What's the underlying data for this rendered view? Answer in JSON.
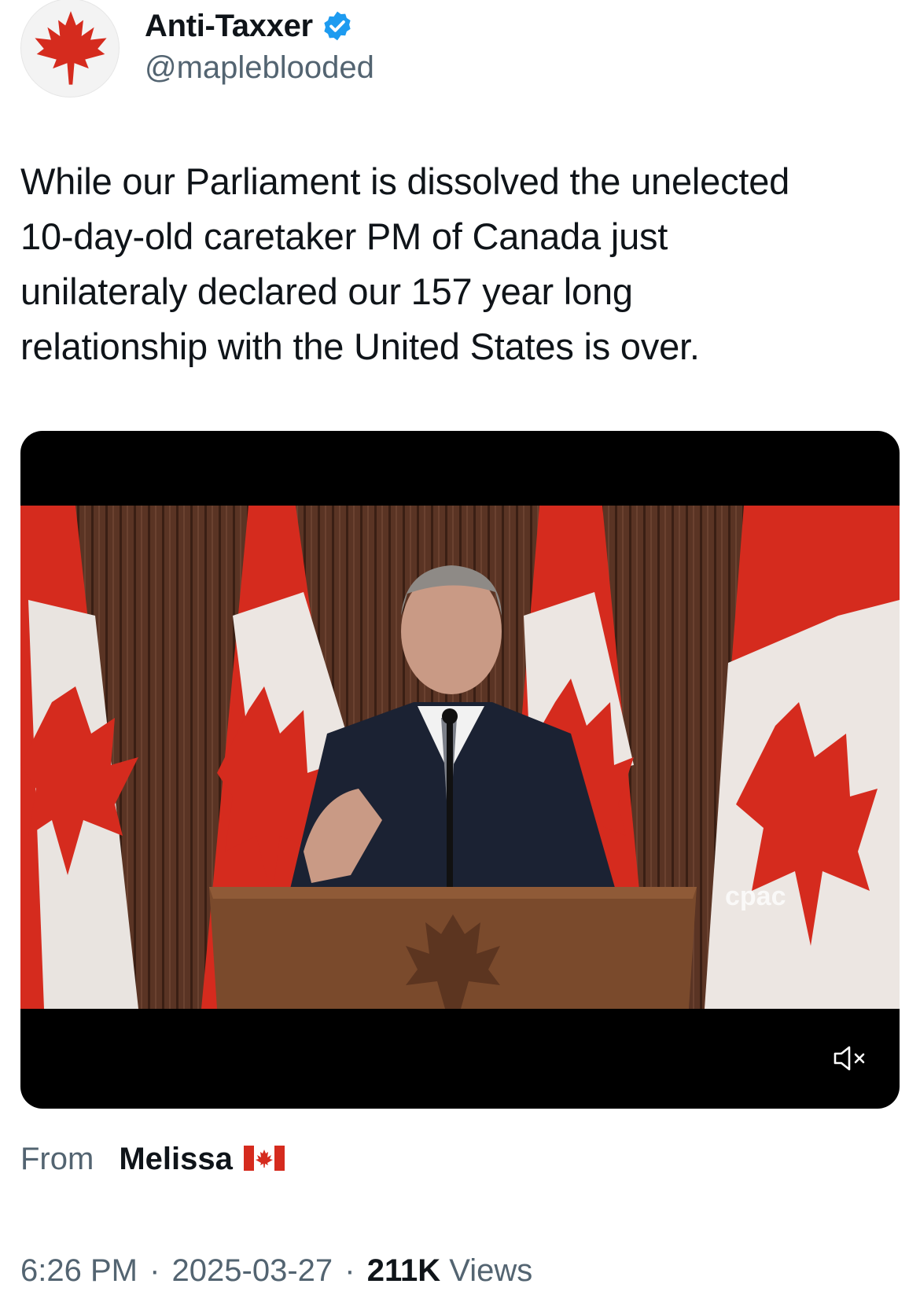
{
  "author": {
    "display_name": "Anti-Taxxer",
    "handle": "@mapleblooded",
    "verified": true,
    "avatar_icon": "maple-leaf-icon",
    "verified_color": "#1d9bf0"
  },
  "tweet": {
    "lines": [
      "While our Parliament is dissolved the unelected",
      "10-day-old caretaker PM of Canada just",
      "unilateraly declared our 157 year long",
      "relationship with the United States is over."
    ]
  },
  "video": {
    "watermark": "cpac",
    "mute_icon": "speaker-muted-icon"
  },
  "source": {
    "label": "From",
    "name": "Melissa",
    "flag_icon": "canada-flag-icon"
  },
  "meta": {
    "time": "6:26 PM",
    "date": "2025-03-27",
    "views_count": "211K",
    "views_label": "Views",
    "separator": "·"
  },
  "colors": {
    "text_primary": "#0f1419",
    "text_secondary": "#536471",
    "flag_red": "#d52b1e"
  }
}
